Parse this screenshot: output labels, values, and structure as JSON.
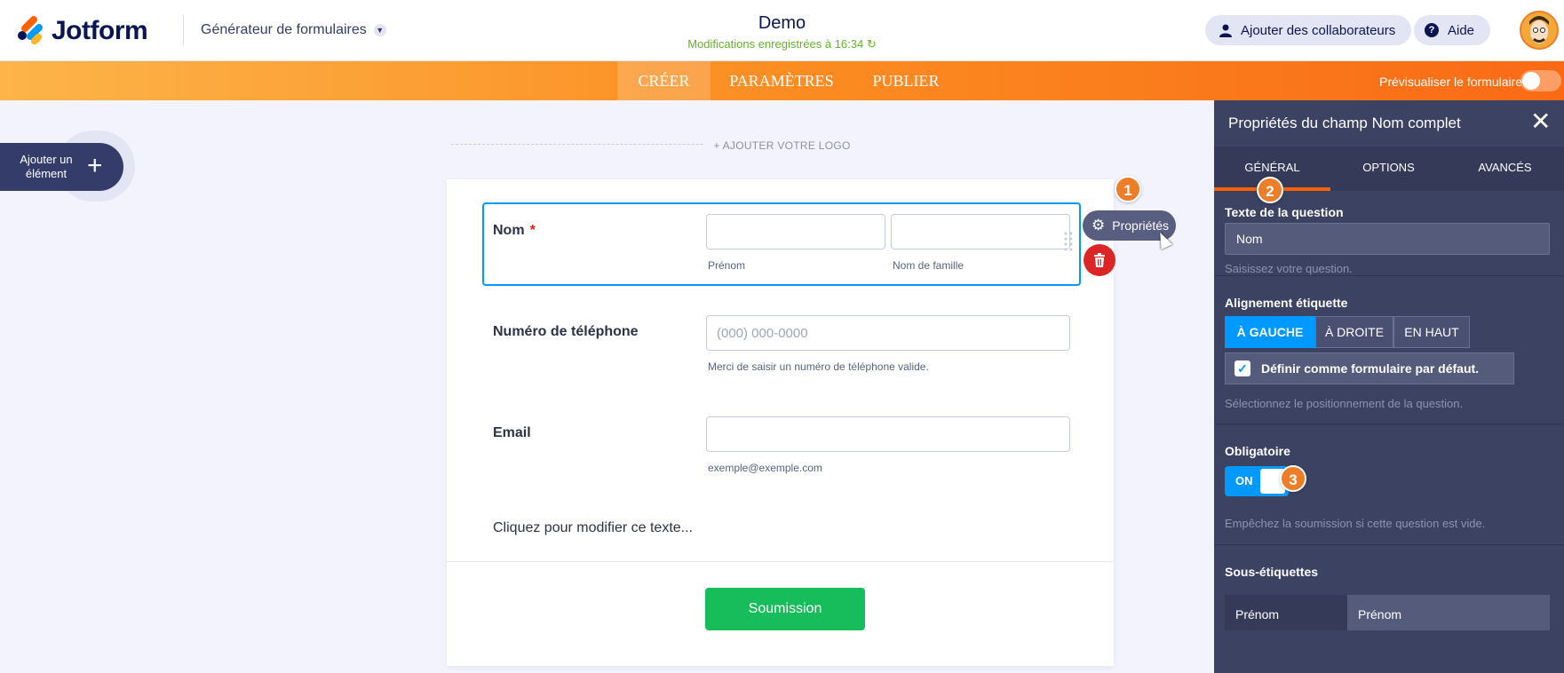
{
  "header": {
    "logo_text": "Jotform",
    "builder_label": "Générateur de formulaires",
    "form_title": "Demo",
    "saved_status": "Modifications enregistrées à 16:34",
    "collab_label": "Ajouter des collaborateurs",
    "help_label": "Aide"
  },
  "nav": {
    "tabs": [
      {
        "label": "CRÉER",
        "active": true
      },
      {
        "label": "PARAMÈTRES",
        "active": false
      },
      {
        "label": "PUBLIER",
        "active": false
      }
    ],
    "preview_label": "Prévisualiser le formulaire"
  },
  "canvas": {
    "add_element_label": "Ajouter un élément",
    "logo_placeholder": "+ AJOUTER VOTRE LOGO"
  },
  "form": {
    "fields": {
      "name": {
        "label": "Nom",
        "required_mark": "*",
        "first_sublabel": "Prénom",
        "last_sublabel": "Nom de famille"
      },
      "phone": {
        "label": "Numéro de téléphone",
        "placeholder": "(000) 000-0000",
        "sublabel": "Merci de saisir un numéro de téléphone valide."
      },
      "email": {
        "label": "Email",
        "sublabel": "exemple@exemple.com"
      }
    },
    "text_block": "Cliquez pour modifier ce texte...",
    "submit_label": "Soumission"
  },
  "floating": {
    "properties_label": "Propriétés",
    "badges": [
      "1",
      "2",
      "3"
    ]
  },
  "panel": {
    "title": "Propriétés du champ Nom complet",
    "tabs": [
      {
        "label": "GÉNÉRAL",
        "active": true
      },
      {
        "label": "OPTIONS",
        "active": false
      },
      {
        "label": "AVANCÉS",
        "active": false
      }
    ],
    "question_text": {
      "title": "Texte de la question",
      "value": "Nom",
      "hint": "Saisissez votre question."
    },
    "label_alignment": {
      "title": "Alignement étiquette",
      "options": [
        {
          "label": "À GAUCHE",
          "active": true
        },
        {
          "label": "À DROITE",
          "active": false
        },
        {
          "label": "EN HAUT",
          "active": false
        }
      ],
      "default_checkbox": "Définir comme formulaire par défaut.",
      "hint": "Sélectionnez le positionnement de la question."
    },
    "required": {
      "title": "Obligatoire",
      "toggle_label": "ON",
      "hint": "Empêchez la soumission si cette question est vide."
    },
    "sublabels": {
      "title": "Sous-étiquettes",
      "key": "Prénom",
      "value": "Prénom"
    }
  },
  "colors": {
    "accent_orange": "#fa6a15",
    "blue": "#0099ff",
    "submit_green": "#18bd5b",
    "panel_bg": "#3c4262",
    "delete_red": "#dc2626"
  }
}
